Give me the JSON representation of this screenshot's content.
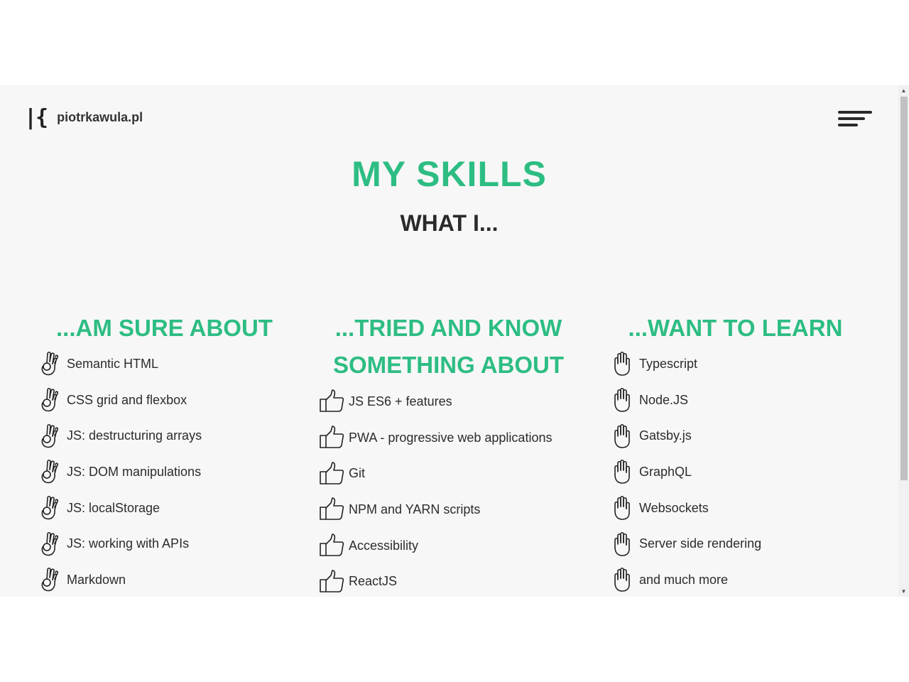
{
  "logo": {
    "mark": "|{",
    "text": "piotrkawula.pl"
  },
  "page": {
    "title": "MY SKILLS",
    "subtitle": "WHAT I..."
  },
  "columns": [
    {
      "heading": "...AM SURE ABOUT",
      "icon": "ok-hand-icon",
      "items": [
        "Semantic HTML",
        "CSS grid and flexbox",
        "JS: destructuring arrays",
        "JS: DOM manipulations",
        "JS: localStorage",
        "JS: working with APIs",
        "Markdown"
      ]
    },
    {
      "heading": "...TRIED AND KNOW SOMETHING ABOUT",
      "icon": "thumbs-up-icon",
      "items": [
        "JS ES6 + features",
        "PWA - progressive web applications",
        "Git",
        "NPM and YARN scripts",
        "Accessibility",
        "ReactJS"
      ]
    },
    {
      "heading": "...WANT TO LEARN",
      "icon": "raised-hand-icon",
      "items": [
        "Typescript",
        "Node.JS",
        "Gatsby.js",
        "GraphQL",
        "Websockets",
        "Server side rendering",
        "and much more"
      ]
    }
  ],
  "colors": {
    "accent": "#2dbd83",
    "text": "#2a2a2a",
    "background": "#f7f7f7"
  }
}
